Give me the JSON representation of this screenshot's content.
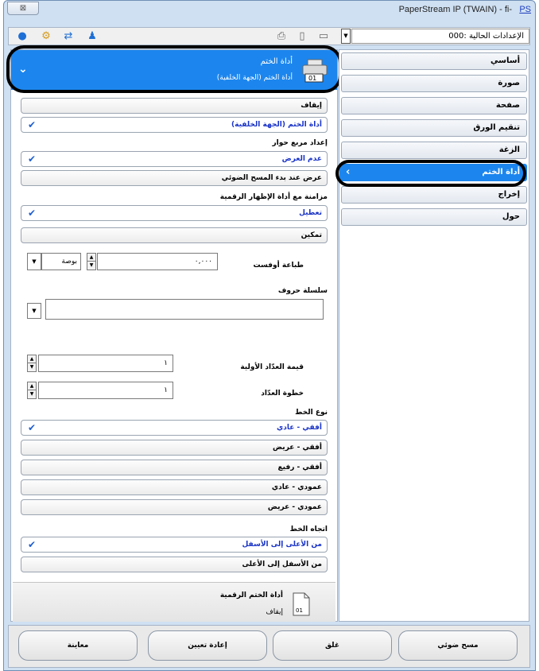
{
  "window": {
    "title": "PaperStream IP (TWAIN) - fi-",
    "ps_label": "PS",
    "close_glyph": "⊠"
  },
  "toolbar": {
    "current_settings": "000: الإعدادات الحالية"
  },
  "nav": {
    "items": [
      "أساسي",
      "صورة",
      "صفحة",
      "تنقيم الورق",
      "الزغة",
      "أداة الختم",
      "إخراج",
      "حول"
    ],
    "active_index": 5
  },
  "header": {
    "title": "أداة الختم",
    "subtitle": "أداة الختم (الجهة الخلفية)",
    "icon_code": "01"
  },
  "mode": {
    "options": [
      "إيقاف",
      "أداة الختم (الجهة الخلفية)"
    ],
    "selected": 1
  },
  "preview_frame": {
    "label": "إعداد مربع حوار",
    "options": [
      "عدم العرض",
      "عرض عند بدء المسح الضوئي"
    ],
    "selected": 0
  },
  "sync": {
    "label": "مزامنة مع أداة الإظهار الرقمية",
    "options": [
      "تعطيل",
      "تمكين"
    ],
    "selected": 0
  },
  "offset": {
    "label": "طباعة أوفست",
    "value": "٠,٠٠٠",
    "unit": "بوصة"
  },
  "char_string": {
    "label": "سلسلة حروف",
    "value": ""
  },
  "counter_initial": {
    "label": "قيمة العدّاد الأولية",
    "value": "١"
  },
  "counter_step": {
    "label": "خطوة العدّاد",
    "value": "١"
  },
  "font_type": {
    "label": "نوع الخط",
    "options": [
      "أفقي - عادي",
      "أفقي - عريض",
      "أفقي - رفيع",
      "عمودي - عادي",
      "عمودي - عريض"
    ],
    "selected": 0
  },
  "direction": {
    "label": "اتجاه الخط",
    "options": [
      "من الأعلى إلى الأسفل",
      "من الأسفل إلى الأعلى"
    ],
    "selected": 0
  },
  "digital_endorser": {
    "title": "أداة الختم الرقمية",
    "status": "إيقاف",
    "icon_code": "01"
  },
  "buttons": {
    "preview": "معاينة",
    "reset": "إعادة تعيين",
    "close": "غلق",
    "scan": "مسح ضوئي"
  },
  "colors": {
    "accent": "#1c86ee",
    "selected_text": "#1933c7",
    "check": "#1f5fd0",
    "window_frame": "#cfe0f2"
  }
}
